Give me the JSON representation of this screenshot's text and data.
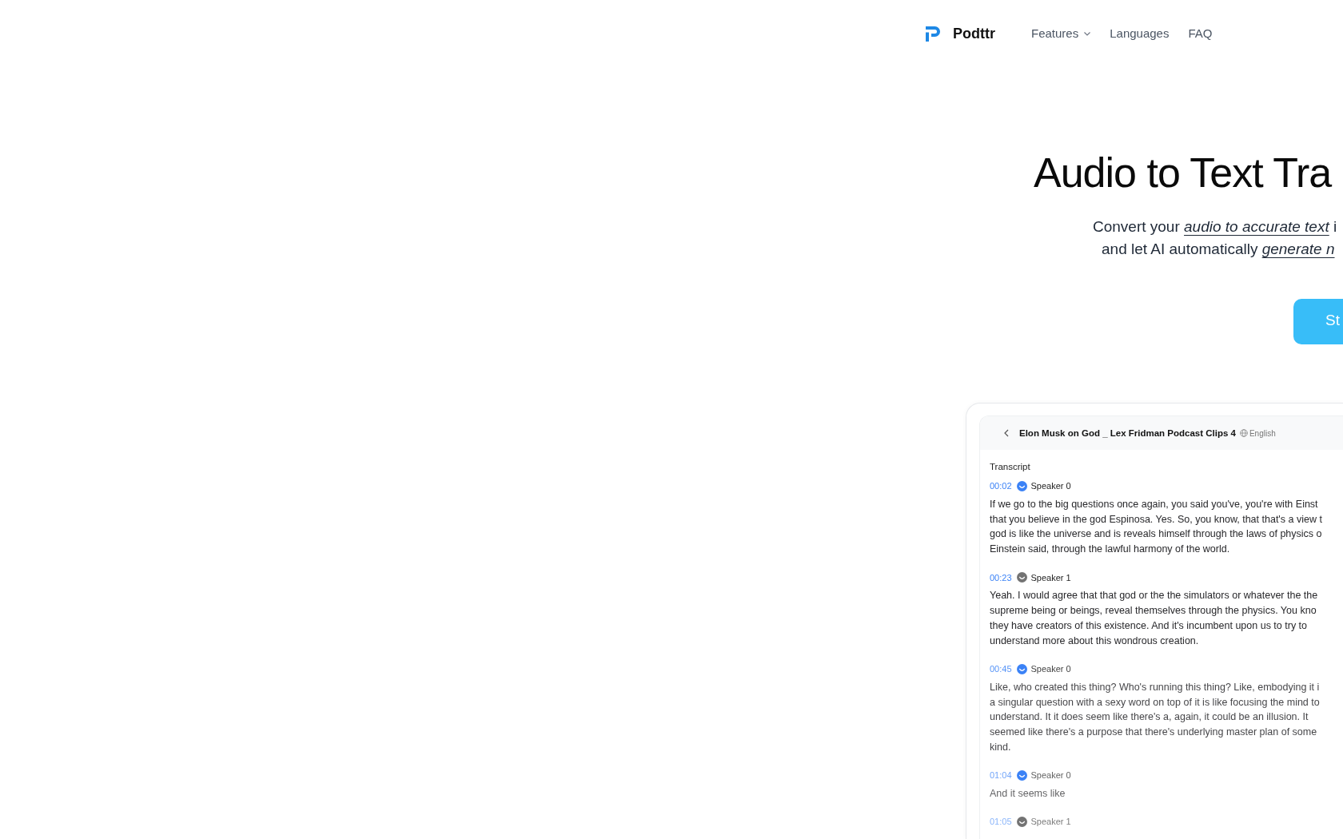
{
  "nav": {
    "brand": "Podttr",
    "links": [
      {
        "label": "Features",
        "kind": "dropdown"
      },
      {
        "label": "Languages",
        "kind": "link"
      },
      {
        "label": "FAQ",
        "kind": "link"
      }
    ]
  },
  "hero": {
    "title": "Audio to Text Tra",
    "subtitle_lines": [
      "Convert your *audio to accurate text* i",
      "and let AI automatically *generate n*"
    ],
    "button": "St"
  },
  "preview": {
    "title": "Elon Musk on God _ Lex Fridman Podcast Clips 4",
    "language": "English",
    "section": "Transcript",
    "segments": [
      {
        "time": "00:02",
        "speaker": "Speaker 0",
        "color": "#3b82f6",
        "lines": [
          "If we go to the big questions once again, you said you've, you're with Einst",
          "that you believe in the god Espinosa. Yes. So, you know, that that's a view t",
          "god is like the universe and is reveals himself through the laws of physics o",
          "Einstein said, through the lawful harmony of the world."
        ]
      },
      {
        "time": "00:23",
        "speaker": "Speaker 1",
        "color": "#737373",
        "lines": [
          "Yeah. I would agree that that god or the the simulators or whatever the the",
          "supreme being or beings, reveal themselves through the physics. You kno",
          "they have creators of this existence. And it's incumbent upon us to try to",
          "understand more about this wondrous creation."
        ]
      },
      {
        "time": "00:45",
        "speaker": "Speaker 0",
        "color": "#3b82f6",
        "lines": [
          "Like, who created this thing? Who's running this thing? Like, embodying it i",
          "a singular question with a sexy word on top of it is like focusing the mind to",
          "understand. It it does seem like there's a, again, it could be an illusion. It",
          "seemed like there's a purpose that there's underlying master plan of some",
          "kind."
        ]
      },
      {
        "time": "01:04",
        "speaker": "Speaker 0",
        "color": "#3b82f6",
        "lines": [
          "And it seems like"
        ]
      },
      {
        "time": "01:05",
        "speaker": "Speaker 1",
        "color": "#737373"
      }
    ]
  }
}
